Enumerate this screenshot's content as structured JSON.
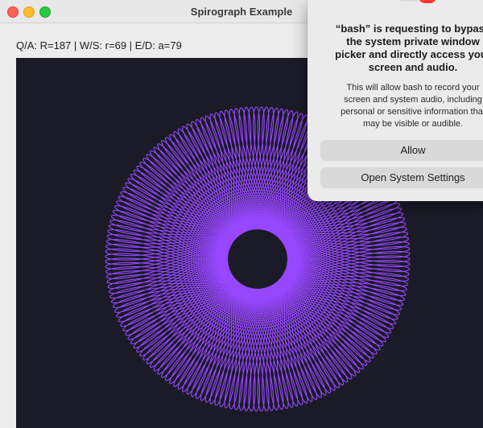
{
  "window": {
    "title": "Spirograph Example",
    "controls_text": "Q/A: R=187 | W/S: r=69 | E/D: a=79"
  },
  "spirograph": {
    "R": 187,
    "r": 69,
    "a": 79,
    "color": "#9747ff",
    "background": "#1b1b27"
  },
  "dialog": {
    "title_lines": [
      "“bash” is requesting to bypass",
      "the system private window",
      "picker and directly access your",
      "screen and audio."
    ],
    "body_lines": [
      "This will allow bash to record your",
      "screen and system audio, including",
      "personal or sensitive information that",
      "may be visible or audible."
    ],
    "allow_label": "Allow",
    "settings_label": "Open System Settings"
  }
}
